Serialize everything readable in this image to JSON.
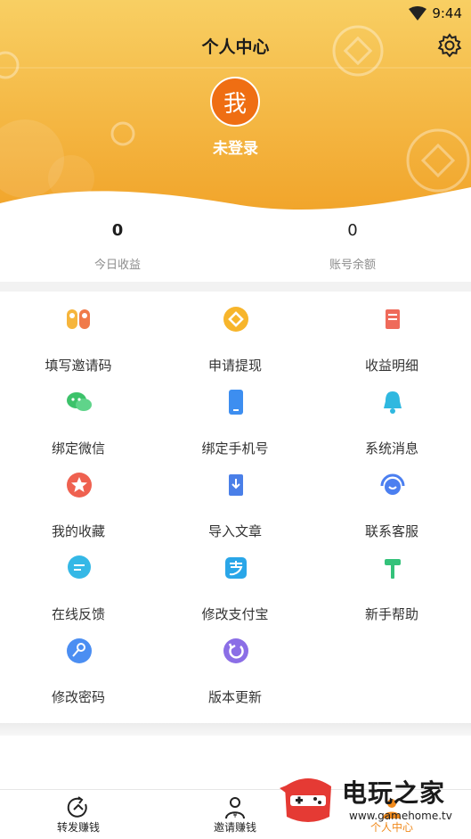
{
  "status_bar": {
    "time": "9:44"
  },
  "header": {
    "title": "个人中心",
    "avatar_text": "我",
    "login_status": "未登录"
  },
  "stats": [
    {
      "value": "0",
      "label": "今日收益"
    },
    {
      "value": "0",
      "label": "账号余额"
    }
  ],
  "menu": [
    {
      "label": "填写邀请码",
      "icon": "invite-code-icon"
    },
    {
      "label": "申请提现",
      "icon": "withdraw-coin-icon"
    },
    {
      "label": "收益明细",
      "icon": "income-detail-icon"
    },
    {
      "label": "绑定微信",
      "icon": "wechat-icon"
    },
    {
      "label": "绑定手机号",
      "icon": "phone-icon"
    },
    {
      "label": "系统消息",
      "icon": "bell-icon"
    },
    {
      "label": "我的收藏",
      "icon": "star-icon"
    },
    {
      "label": "导入文章",
      "icon": "import-article-icon"
    },
    {
      "label": "联系客服",
      "icon": "customer-service-icon"
    },
    {
      "label": "在线反馈",
      "icon": "feedback-chat-icon"
    },
    {
      "label": "修改支付宝",
      "icon": "alipay-icon"
    },
    {
      "label": "新手帮助",
      "icon": "help-hammer-icon"
    },
    {
      "label": "修改密码",
      "icon": "key-icon"
    },
    {
      "label": "版本更新",
      "icon": "refresh-icon"
    }
  ],
  "tabs": [
    {
      "label": "转发赚钱",
      "icon": "share-icon"
    },
    {
      "label": "邀请赚钱",
      "icon": "invite-user-icon"
    },
    {
      "label": "个人中心",
      "icon": "profile-icon"
    }
  ],
  "watermark": {
    "brand": "电玩之家",
    "url": "www.gamehome.tv"
  },
  "colors": {
    "header_top": "#f7c85a",
    "header_bottom": "#f1a52c",
    "avatar": "#ef6e13",
    "active_tab": "#f08a1c"
  }
}
